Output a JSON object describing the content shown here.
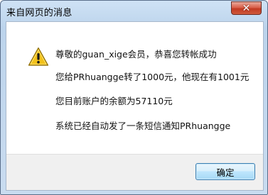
{
  "dialog": {
    "title": "来自网页的消息",
    "close_glyph": "✕",
    "icon": "warning-icon",
    "messages": [
      "尊敬的guan_xige会员，恭喜您转帐成功",
      "您给PRhuangge转了1000元，他现在有1001元",
      "您目前账户的余额为57110元",
      "系统已经自动发了一条短信通知PRhuangge"
    ],
    "ok_label": "确定"
  },
  "colors": {
    "frame": "#c3d8ee",
    "close_button": "#c23a22",
    "warning_fill": "#f2c21b",
    "button_border": "#3c7fb1"
  }
}
